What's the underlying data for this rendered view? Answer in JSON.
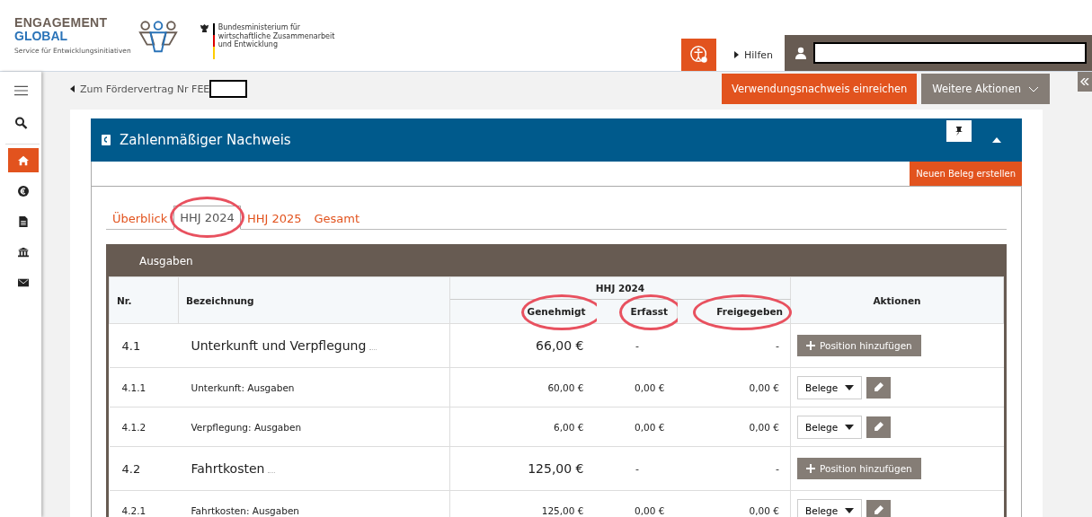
{
  "header": {
    "logo": {
      "line1": "ENGAGEMENT",
      "line2": "GLOBAL",
      "tagline": "Service für Entwicklungsinitiativen"
    },
    "ministry": [
      "Bundesministerium für",
      "wirtschaftliche Zusammenarbeit",
      "und Entwicklung"
    ],
    "help_link": "Hilfen"
  },
  "sidebar": {
    "items": [
      {
        "selected": true
      },
      {
        "selected": false
      },
      {
        "selected": false
      },
      {
        "selected": false
      },
      {
        "selected": false
      }
    ]
  },
  "breadcrumb": "Zum Fördervertrag Nr FEE",
  "actions": {
    "primary": "Verwendungsnachweis einreichen",
    "secondary": "Weitere Aktionen"
  },
  "panel": {
    "title": "Zahlenmäßiger Nachweis",
    "new_button": "Neuen Beleg erstellen",
    "tabs": [
      {
        "label": "Überblick",
        "selected": false,
        "circled": false
      },
      {
        "label": "HHJ 2024",
        "selected": true,
        "circled": true
      },
      {
        "label": "HHJ 2025",
        "selected": false,
        "circled": false
      },
      {
        "label": "Gesamt",
        "selected": false,
        "circled": false
      }
    ],
    "table": {
      "title": "Ausgaben",
      "columns": {
        "nr": "Nr.",
        "name": "Bezeichnung",
        "group": "HHJ 2024",
        "actions": "Aktionen"
      },
      "subcolumns": [
        {
          "label": "Genehmigt",
          "circled": true
        },
        {
          "label": "Erfasst",
          "circled": true
        },
        {
          "label": "Freigegeben",
          "circled": true
        }
      ],
      "rows": [
        {
          "kind": "group",
          "nr": "4.1",
          "name": "Unterkunft und Verpflegung",
          "values": [
            "66,00 €",
            "-",
            "-"
          ],
          "action": "Position hinzufügen"
        },
        {
          "kind": "item",
          "nr": "4.1.1",
          "name": "Unterkunft: Ausgaben",
          "values": [
            "60,00 €",
            "0,00 €",
            "0,00 €"
          ],
          "action": "Belege"
        },
        {
          "kind": "item",
          "nr": "4.1.2",
          "name": "Verpflegung: Ausgaben",
          "values": [
            "6,00 €",
            "0,00 €",
            "0,00 €"
          ],
          "action": "Belege"
        },
        {
          "kind": "group",
          "nr": "4.2",
          "name": "Fahrtkosten",
          "values": [
            "125,00 €",
            "-",
            "-"
          ],
          "action": "Position hinzufügen"
        },
        {
          "kind": "item",
          "nr": "4.2.1",
          "name": "Fahrtkosten: Ausgaben",
          "values": [
            "125,00 €",
            "0,00 €",
            "0,00 €"
          ],
          "action": "Belege"
        }
      ]
    }
  }
}
